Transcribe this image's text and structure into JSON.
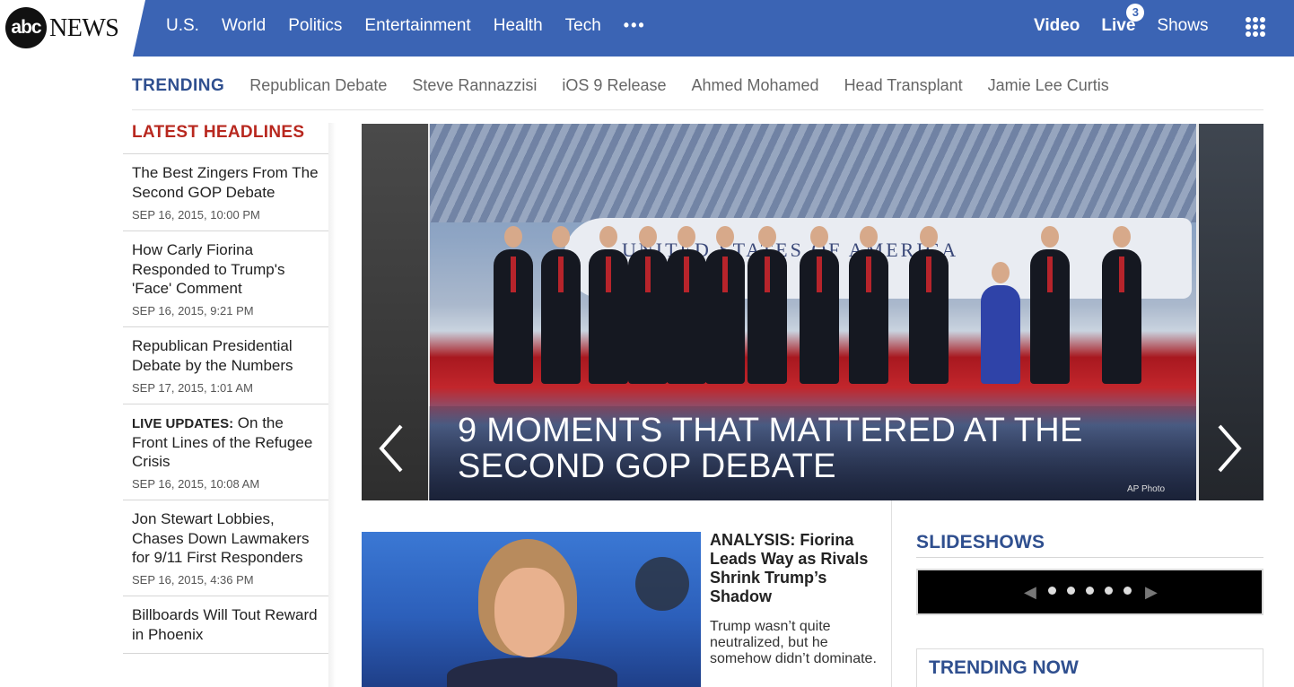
{
  "brand": {
    "logo_mark": "abc",
    "logo_text": "NEWS"
  },
  "nav": {
    "items": [
      "U.S.",
      "World",
      "Politics",
      "Entertainment",
      "Health",
      "Tech"
    ],
    "more": "•••",
    "video": "Video",
    "live": "Live",
    "live_count": "3",
    "shows": "Shows",
    "menu_icon": "grid-menu-icon"
  },
  "trending": {
    "label": "TRENDING",
    "items": [
      "Republican Debate",
      "Steve Rannazzisi",
      "iOS 9 Release",
      "Ahmed Mohamed",
      "Head Transplant",
      "Jamie Lee Curtis"
    ]
  },
  "latest": {
    "title": "LATEST HEADLINES",
    "items": [
      {
        "prefix": "",
        "title": "The Best Zingers From The Second GOP Debate",
        "date": "SEP 16, 2015, 10:00 PM"
      },
      {
        "prefix": "",
        "title": "How Carly Fiorina Responded to Trump's 'Face' Comment",
        "date": "SEP 16, 2015, 9:21 PM"
      },
      {
        "prefix": "",
        "title": "Republican Presidential Debate by the Numbers",
        "date": "SEP 17, 2015, 1:01 AM"
      },
      {
        "prefix": "LIVE UPDATES:",
        "title": " On the Front Lines of the Refugee Crisis",
        "date": "SEP 16, 2015, 10:08 AM"
      },
      {
        "prefix": "",
        "title": "Jon Stewart Lobbies, Chases Down Lawmakers for 9/11 First Responders",
        "date": "SEP 16, 2015, 4:36 PM"
      },
      {
        "prefix": "",
        "title": "Billboards Will Tout Reward in Phoenix",
        "date": ""
      }
    ]
  },
  "hero": {
    "caption": "9 MOMENTS THAT MATTERED AT THE SECOND GOP DEBATE",
    "credit": "AP Photo",
    "plane_text": "UNITED STATES OF AMERICA"
  },
  "feature": {
    "title": "ANALYSIS: Fiorina Leads Way as Rivals Shrink Trump’s Shadow",
    "summary": "Trump wasn’t quite neutralized, but he somehow didn’t dominate."
  },
  "slideshows": {
    "title": "SLIDESHOWS",
    "dot_count": 5
  },
  "trending_now": {
    "title": "TRENDING NOW"
  },
  "colors": {
    "nav_bg": "#3b64b4",
    "headline_red": "#b8281f",
    "section_blue": "#2f4f8f"
  }
}
